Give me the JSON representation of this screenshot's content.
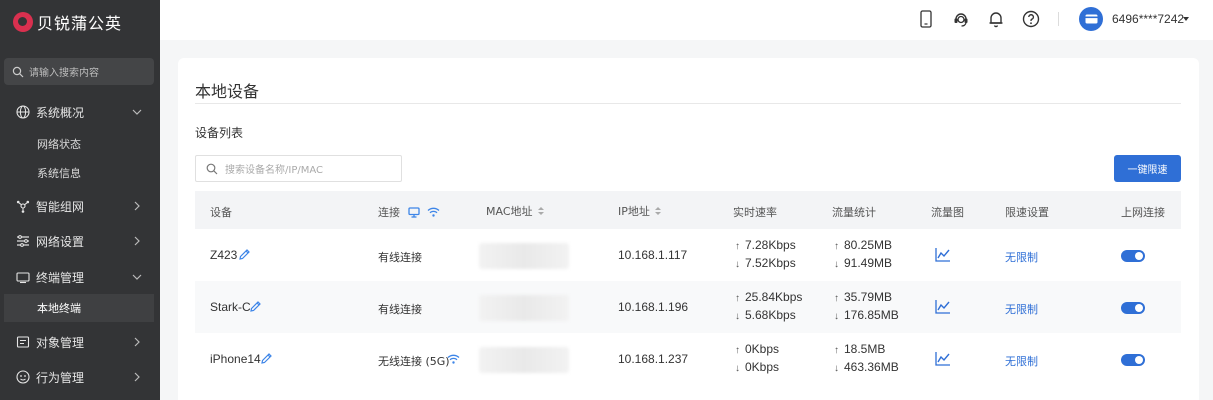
{
  "app": {
    "brand": "贝锐蒲公英"
  },
  "sidebar": {
    "search_placeholder": "请输入搜索内容",
    "menu": [
      {
        "label": "系统概况",
        "expanded": true,
        "children": [
          "网络状态",
          "系统信息"
        ]
      },
      {
        "label": "智能组网",
        "expanded": false
      },
      {
        "label": "网络设置",
        "expanded": false
      },
      {
        "label": "终端管理",
        "expanded": true,
        "children": [
          "本地终端"
        ],
        "active_child": "本地终端"
      },
      {
        "label": "对象管理",
        "expanded": false
      },
      {
        "label": "行为管理",
        "expanded": false
      }
    ]
  },
  "header": {
    "username": "6496****7242"
  },
  "page": {
    "title": "本地设备",
    "section_title": "设备列表",
    "search_placeholder": "搜索设备名称/IP/MAC",
    "limit_button": "一键限速"
  },
  "table": {
    "columns": [
      "设备",
      "连接",
      "MAC地址",
      "IP地址",
      "实时速率",
      "流量统计",
      "流量图",
      "限速设置",
      "上网连接"
    ],
    "rows": [
      {
        "device": "Z423",
        "connection": "有线连接",
        "ip": "10.168.1.117",
        "rate_up": "7.28Kbps",
        "rate_down": "7.52Kbps",
        "traffic_up": "80.25MB",
        "traffic_down": "91.49MB",
        "limit": "无限制",
        "online": true
      },
      {
        "device": "Stark-C",
        "connection": "有线连接",
        "ip": "10.168.1.196",
        "rate_up": "25.84Kbps",
        "rate_down": "5.68Kbps",
        "traffic_up": "35.79MB",
        "traffic_down": "176.85MB",
        "limit": "无限制",
        "online": true
      },
      {
        "device": "iPhone14",
        "connection": "无线连接 (5G)",
        "ip": "10.168.1.237",
        "rate_up": "0Kbps",
        "rate_down": "0Kbps",
        "traffic_up": "18.5MB",
        "traffic_down": "463.36MB",
        "limit": "无限制",
        "online": true
      }
    ]
  },
  "colors": {
    "accent": "#2f6fd6",
    "sidebar": "#333436",
    "brand": "#d9304f"
  }
}
